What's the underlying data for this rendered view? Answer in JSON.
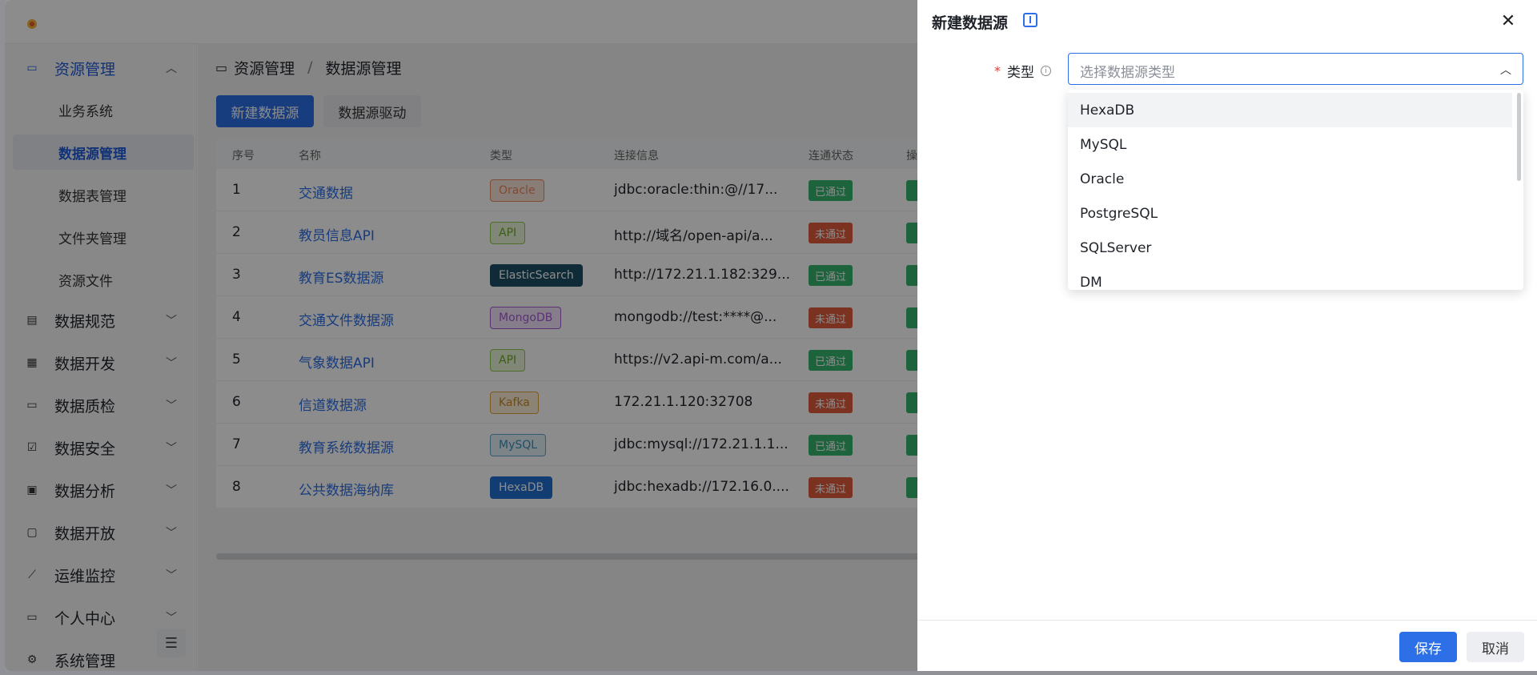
{
  "sidebar": {
    "items": [
      {
        "label": "资源管理",
        "icon": "resource-icon",
        "open": true
      },
      {
        "label": "数据规范",
        "icon": "spec-icon"
      },
      {
        "label": "数据开发",
        "icon": "develop-icon"
      },
      {
        "label": "数据质检",
        "icon": "quality-icon"
      },
      {
        "label": "数据安全",
        "icon": "security-icon"
      },
      {
        "label": "数据分析",
        "icon": "analysis-icon"
      },
      {
        "label": "数据开放",
        "icon": "open-icon"
      },
      {
        "label": "运维监控",
        "icon": "monitor-icon"
      },
      {
        "label": "个人中心",
        "icon": "user-icon"
      },
      {
        "label": "系统管理",
        "icon": "system-icon"
      }
    ],
    "subitems": [
      "业务系统",
      "数据源管理",
      "数据表管理",
      "文件夹管理",
      "资源文件"
    ],
    "active_sub": "数据源管理"
  },
  "breadcrumb": {
    "root": "资源管理",
    "sep": "/",
    "current": "数据源管理"
  },
  "toolbar": {
    "new_label": "新建数据源",
    "driver_label": "数据源驱动"
  },
  "table": {
    "headers": [
      "序号",
      "名称",
      "类型",
      "连接信息",
      "连通状态",
      "操"
    ],
    "rows": [
      {
        "no": "1",
        "name": "交通数据",
        "type": "Oracle",
        "conn": "jdbc:oracle:thin:@//17...",
        "status": "已通过"
      },
      {
        "no": "2",
        "name": "教员信息API",
        "type": "API",
        "conn": "http://域名/open-api/a...",
        "status": "未通过"
      },
      {
        "no": "3",
        "name": "教育ES数据源",
        "type": "ElasticSearch",
        "conn": "http://172.21.1.182:329...",
        "status": "已通过"
      },
      {
        "no": "4",
        "name": "交通文件数据源",
        "type": "MongoDB",
        "conn": "mongodb://test:****@...",
        "status": "未通过"
      },
      {
        "no": "5",
        "name": "气象数据API",
        "type": "API",
        "conn": "https://v2.api-m.com/a...",
        "status": "已通过"
      },
      {
        "no": "6",
        "name": "信道数据源",
        "type": "Kafka",
        "conn": "172.21.1.120:32708",
        "status": "未通过"
      },
      {
        "no": "7",
        "name": "教育系统数据源",
        "type": "MySQL",
        "conn": "jdbc:mysql://172.21.1.1...",
        "status": "已通过"
      },
      {
        "no": "8",
        "name": "公共数据海纳库",
        "type": "HexaDB",
        "conn": "jdbc:hexadb://172.16.0....",
        "status": "未通过"
      }
    ]
  },
  "drawer": {
    "title": "新建数据源",
    "field_label": "类型",
    "field_required": "*",
    "placeholder": "选择数据源类型",
    "options": [
      "HexaDB",
      "MySQL",
      "Oracle",
      "PostgreSQL",
      "SQLServer",
      "DM"
    ],
    "save_label": "保存",
    "cancel_label": "取消"
  },
  "colors": {
    "primary": "#2c6fe6",
    "ok": "#35b46e",
    "bad": "#e15b3c"
  }
}
